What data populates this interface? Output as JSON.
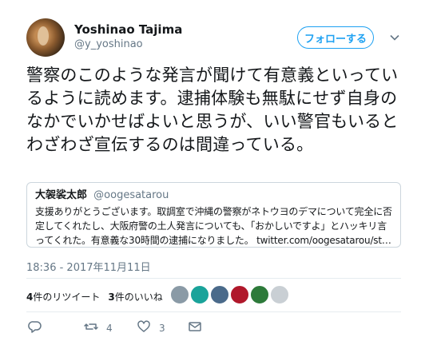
{
  "user": {
    "name": "Yoshinao Tajima",
    "handle": "@y_yoshinao"
  },
  "follow_button": {
    "label": "フォローする"
  },
  "tweet": {
    "text": "警察のこのような発言が聞けて有意義といっているように読めます。逮捕体験も無駄にせず自身のなかでいかせばよいと思うが、いい警官もいるとわざわざ宣伝するのは間違っている。"
  },
  "quote": {
    "name": "大袈裟太郎",
    "handle": "@oogesatarou",
    "text": "支援ありがとうございます。取調室で沖縄の警察がネトウヨのデマについて完全に否定してくれたし、大阪府警の土人発言についても、「おかしいですよ」とハッキリ言ってくれた。有意義な30時間の逮捕になりました。 twitter.com/oogesatarou/st…"
  },
  "timestamp": "18:36 - 2017年11月11日",
  "stats": {
    "retweets": "4",
    "retweets_label": "件のリツイート",
    "likes": "3",
    "likes_label": "件のいいね"
  },
  "actions": {
    "retweet_count": "4",
    "like_count": "3"
  },
  "icons": {
    "caret": "chevron-down-icon",
    "reply": "reply-icon",
    "retweet": "retweet-icon",
    "like": "heart-icon",
    "dm": "envelope-icon"
  },
  "colors": {
    "accent": "#1da1f2",
    "secondary_text": "#657786",
    "border": "#ccd6dd"
  }
}
